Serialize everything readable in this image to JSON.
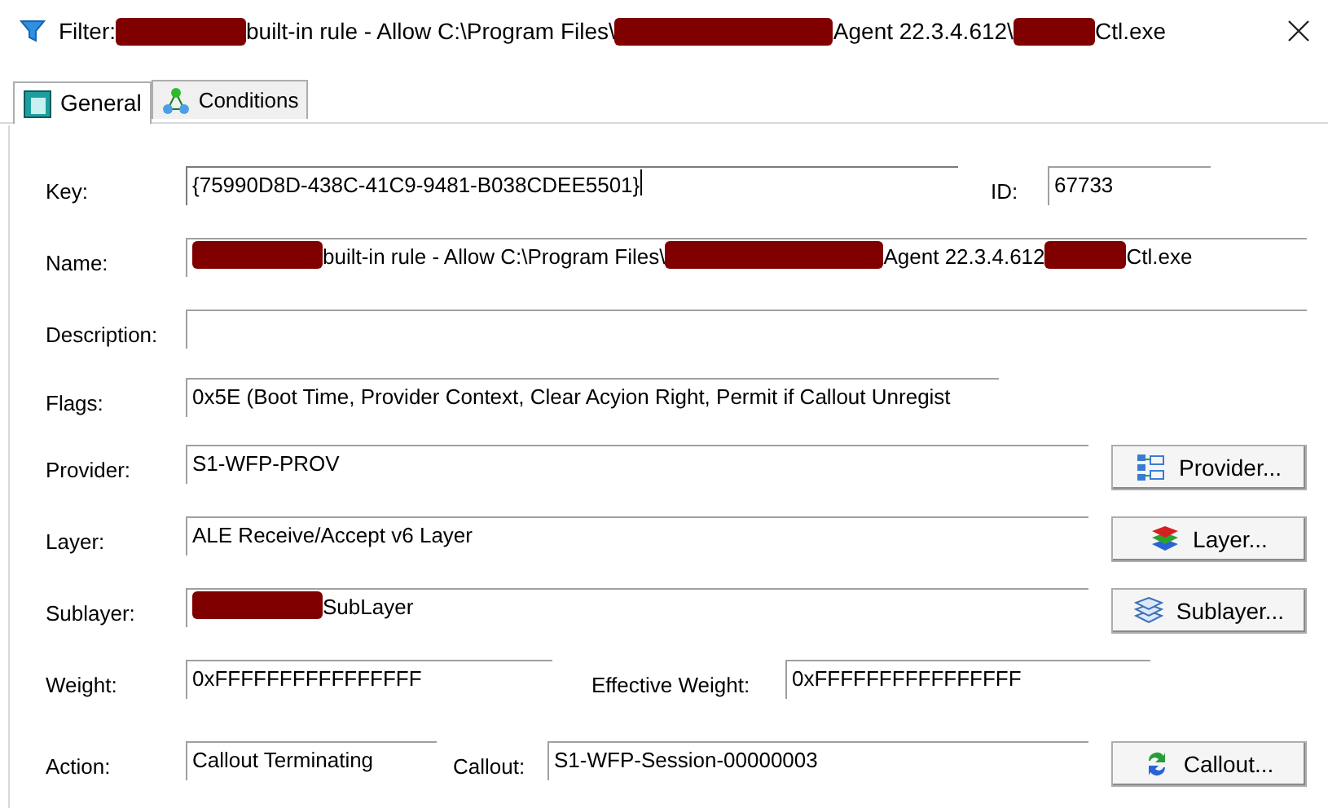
{
  "window": {
    "title": [
      {
        "kind": "text",
        "text": "Filter:"
      },
      {
        "kind": "redacted"
      },
      {
        "kind": "text",
        "text": "built-in rule - Allow C:\\Program Files\\"
      },
      {
        "kind": "redacted"
      },
      {
        "kind": "text",
        "text": "Agent 22.3.4.612\\"
      },
      {
        "kind": "redacted"
      },
      {
        "kind": "text",
        "text": "Ctl.exe"
      }
    ]
  },
  "tabs": [
    {
      "label": "General",
      "selected": true
    },
    {
      "label": "Conditions",
      "selected": false
    }
  ],
  "rows": [
    {
      "cells": [
        {
          "kind": "label",
          "text": "Key:"
        },
        {
          "kind": "field",
          "focused": true,
          "value": [
            {
              "kind": "text",
              "text": "{75990D8D-438C-41C9-9481-B038CDEE5501}"
            }
          ]
        },
        {
          "kind": "label",
          "text": "ID:"
        },
        {
          "kind": "field",
          "focused": false,
          "value": [
            {
              "kind": "text",
              "text": "67733"
            }
          ]
        }
      ]
    },
    {
      "cells": [
        {
          "kind": "label",
          "text": "Name:"
        },
        {
          "kind": "field",
          "focused": false,
          "value": [
            {
              "kind": "redacted"
            },
            {
              "kind": "text",
              "text": "built-in rule - Allow C:\\Program Files\\"
            },
            {
              "kind": "redacted"
            },
            {
              "kind": "text",
              "text": "Agent 22.3.4.612"
            },
            {
              "kind": "redacted"
            },
            {
              "kind": "text",
              "text": "Ctl.exe"
            }
          ]
        }
      ]
    },
    {
      "cells": [
        {
          "kind": "label",
          "text": "Description:"
        },
        {
          "kind": "field",
          "focused": false
        }
      ]
    },
    {
      "cells": [
        {
          "kind": "label",
          "text": "Flags:"
        },
        {
          "kind": "field",
          "focused": false,
          "value": [
            {
              "kind": "text",
              "text": "0x5E (Boot Time, Provider Context, Clear Acyion Right, Permit if Callout Unregist"
            }
          ]
        }
      ]
    },
    {
      "cells": [
        {
          "kind": "label",
          "text": "Provider:"
        },
        {
          "kind": "field",
          "focused": false,
          "value": [
            {
              "kind": "text",
              "text": "S1-WFP-PROV"
            }
          ]
        },
        {
          "kind": "button",
          "label": "Provider..."
        }
      ]
    },
    {
      "cells": [
        {
          "kind": "label",
          "text": "Layer:"
        },
        {
          "kind": "field",
          "focused": false,
          "value": [
            {
              "kind": "text",
              "text": "ALE Receive/Accept v6 Layer"
            }
          ]
        },
        {
          "kind": "button",
          "label": "Layer..."
        }
      ]
    },
    {
      "cells": [
        {
          "kind": "label",
          "text": "Sublayer:"
        },
        {
          "kind": "field",
          "focused": false,
          "value": [
            {
              "kind": "redacted"
            },
            {
              "kind": "text",
              "text": "SubLayer"
            }
          ]
        },
        {
          "kind": "button",
          "label": "Sublayer..."
        }
      ]
    },
    {
      "cells": [
        {
          "kind": "label",
          "text": "Weight:"
        },
        {
          "kind": "field",
          "focused": false,
          "value": [
            {
              "kind": "text",
              "text": "0xFFFFFFFFFFFFFFFF"
            }
          ]
        },
        {
          "kind": "label",
          "text": "Effective Weight:"
        },
        {
          "kind": "field",
          "focused": false,
          "value": [
            {
              "kind": "text",
              "text": "0xFFFFFFFFFFFFFFFF"
            }
          ]
        }
      ]
    },
    {
      "cells": [
        {
          "kind": "label",
          "text": "Action:"
        },
        {
          "kind": "field",
          "focused": false,
          "value": [
            {
              "kind": "text",
              "text": "Callout Terminating"
            }
          ]
        },
        {
          "kind": "label",
          "text": "Callout:"
        },
        {
          "kind": "field",
          "focused": false,
          "value": [
            {
              "kind": "text",
              "text": "S1-WFP-Session-00000003"
            }
          ]
        },
        {
          "kind": "button",
          "label": "Callout..."
        }
      ]
    }
  ]
}
